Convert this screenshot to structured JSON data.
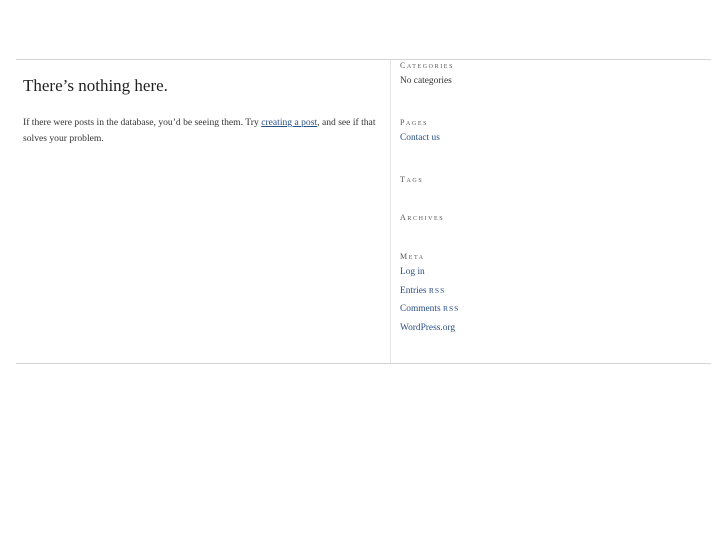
{
  "main": {
    "title": "There’s nothing here.",
    "body_before": "If there were posts in the database, you’d be seeing them. Try ",
    "link_text": "creating a post",
    "body_after": ", and see if that solves your problem."
  },
  "sidebar": {
    "categories": {
      "title": "Categories",
      "empty": "No categories"
    },
    "pages": {
      "title": "Pages",
      "items": [
        "Contact us"
      ]
    },
    "tags": {
      "title": "Tags"
    },
    "archives": {
      "title": "Archives"
    },
    "meta": {
      "title": "Meta",
      "login": "Log in",
      "entries": "Entries",
      "comments": "Comments",
      "rss": "RSS",
      "wordpress": "WordPress.org"
    }
  }
}
